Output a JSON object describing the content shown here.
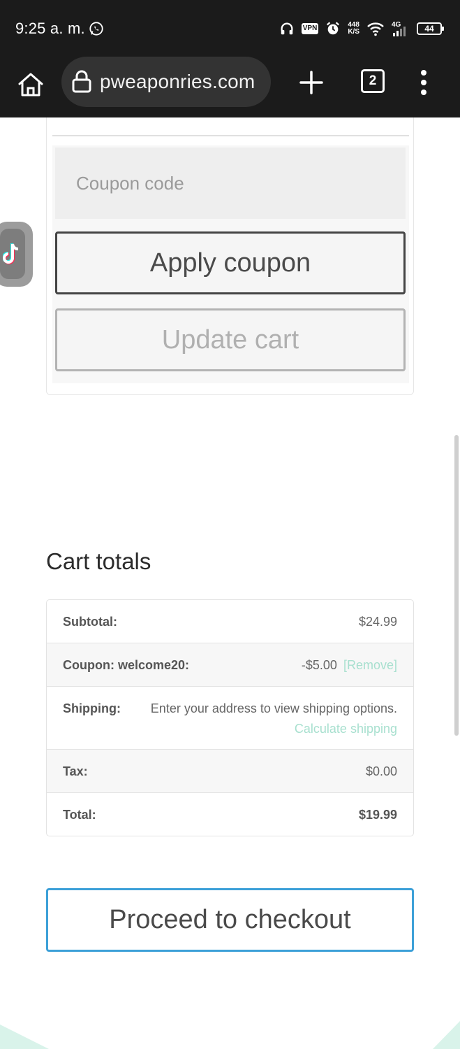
{
  "status_bar": {
    "time": "9:25 a. m.",
    "vpn": "VPN",
    "speed_value": "448",
    "speed_unit": "K/S",
    "network": "4G",
    "battery": "44",
    "icons": [
      "whatsapp-icon",
      "headphones-icon",
      "vpn-icon",
      "alarm-icon",
      "wifi-icon",
      "signal-icon",
      "battery-icon"
    ]
  },
  "browser": {
    "url": "pweaponries.com",
    "tab_count": "2",
    "icons": [
      "home-icon",
      "lock-icon",
      "plus-icon",
      "tabs-icon",
      "more-vert-icon"
    ]
  },
  "coupon": {
    "placeholder": "Coupon code",
    "apply_label": "Apply coupon",
    "update_label": "Update cart"
  },
  "cart_totals": {
    "title": "Cart totals",
    "subtotal_label": "Subtotal:",
    "subtotal_value": "$24.99",
    "coupon_label": "Coupon: welcome20:",
    "coupon_value": "-$5.00",
    "coupon_remove": "[Remove]",
    "shipping_label": "Shipping:",
    "shipping_text": "Enter your address to view shipping options.",
    "shipping_link": "Calculate shipping",
    "tax_label": "Tax:",
    "tax_value": "$0.00",
    "total_label": "Total:",
    "total_value": "$19.99"
  },
  "checkout": {
    "label": "Proceed to checkout"
  },
  "colors": {
    "bar_bg": "#1b1b1b",
    "link": "#a8e0cf",
    "checkout_border": "#3da0d8",
    "deco": "#d9f3ea"
  }
}
